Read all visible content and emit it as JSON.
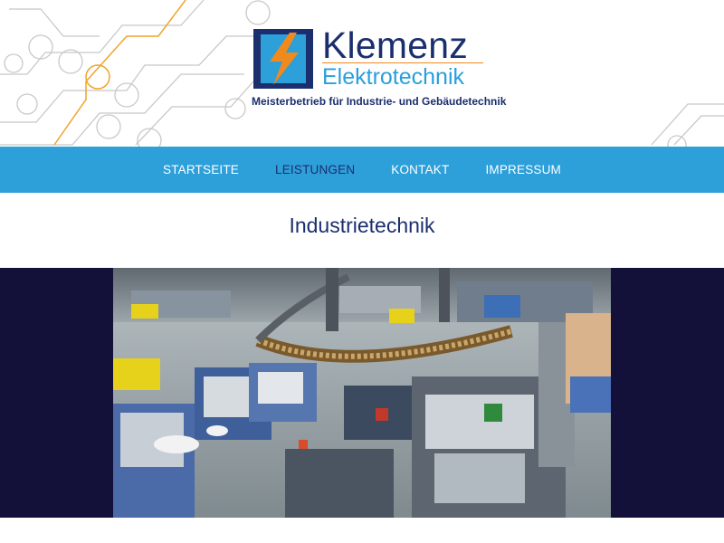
{
  "brand": {
    "name": "Klemenz",
    "subtitle": "Elektrotechnik",
    "tagline": "Meisterbetrieb für Industrie- und Gebäudetechnik",
    "colors": {
      "navy": "#1b2e6e",
      "blue": "#2d9fd9",
      "orange": "#f08a1c",
      "dark_band": "#13113a"
    }
  },
  "nav": {
    "items": [
      {
        "label": "STARTSEITE",
        "active": false
      },
      {
        "label": "LEISTUNGEN",
        "active": true
      },
      {
        "label": "KONTAKT",
        "active": false
      },
      {
        "label": "IMPRESSUM",
        "active": false
      }
    ]
  },
  "page": {
    "title": "Industrietechnik"
  },
  "icons": {
    "logo": "lightning-bolt-icon",
    "decoration": "circuit-lines-icon"
  }
}
